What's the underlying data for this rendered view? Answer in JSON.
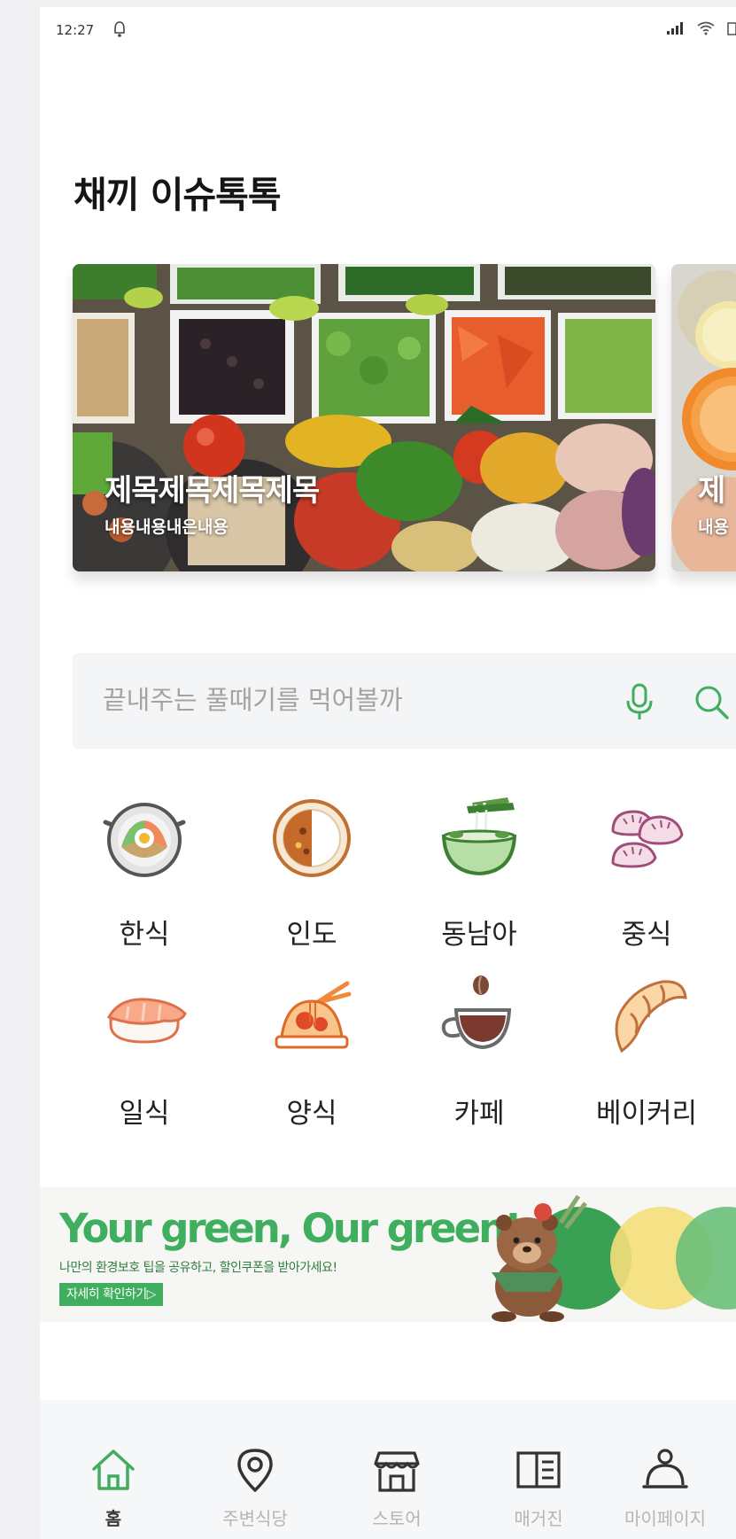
{
  "status_bar": {
    "time": "12:27"
  },
  "page": {
    "title": "채끼 이슈톡톡"
  },
  "carousel": {
    "cards": [
      {
        "title": "제목제목제목제목",
        "subtitle": "내용내용내은내용"
      },
      {
        "title": "제",
        "subtitle": "내용"
      }
    ]
  },
  "search": {
    "placeholder": "끝내주는 풀때기를 먹어볼까"
  },
  "categories": [
    {
      "label": "한식",
      "icon": "bibimbap-pot-icon"
    },
    {
      "label": "인도",
      "icon": "curry-plate-icon"
    },
    {
      "label": "동남아",
      "icon": "noodle-bowl-icon"
    },
    {
      "label": "중식",
      "icon": "dumplings-icon"
    },
    {
      "label": "일식",
      "icon": "sushi-icon"
    },
    {
      "label": "양식",
      "icon": "pasta-icon"
    },
    {
      "label": "카페",
      "icon": "coffee-cup-icon"
    },
    {
      "label": "베이커리",
      "icon": "croissant-icon"
    }
  ],
  "banner": {
    "headline": "Your green, Our green!",
    "subtext": "나만의 환경보호 팁을 공유하고, 할인쿠폰을 받아가세요!",
    "cta": "자세히 확인하기▷"
  },
  "tab_bar": {
    "items": [
      {
        "label": "홈",
        "icon": "home-icon",
        "active": true
      },
      {
        "label": "주변식당",
        "icon": "location-pin-icon",
        "active": false
      },
      {
        "label": "스토어",
        "icon": "store-icon",
        "active": false
      },
      {
        "label": "매거진",
        "icon": "magazine-icon",
        "active": false
      },
      {
        "label": "마이페이지",
        "icon": "user-icon",
        "active": false
      }
    ]
  },
  "colors": {
    "accent_green": "#3fae5e",
    "inactive_tab": "#b5b5b5",
    "search_bg": "#f4f5f7"
  }
}
